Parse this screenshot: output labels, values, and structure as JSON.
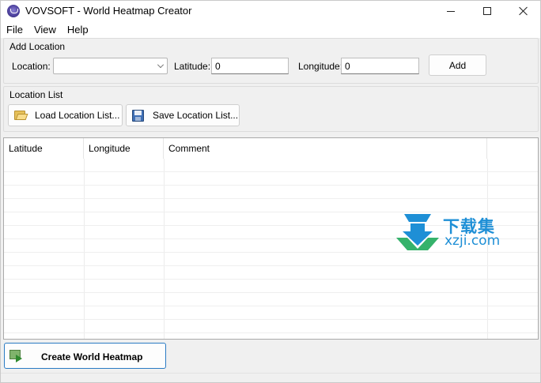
{
  "window": {
    "title": "VOVSOFT - World Heatmap Creator"
  },
  "menu": {
    "items": [
      "File",
      "View",
      "Help"
    ]
  },
  "add_location": {
    "group_title": "Add Location",
    "location_label": "Location:",
    "location_value": "",
    "latitude_label": "Latitude:",
    "latitude_value": "0",
    "longitude_label": "Longitude:",
    "longitude_value": "0",
    "add_button": "Add"
  },
  "location_list": {
    "group_title": "Location List",
    "load_button": "Load Location List...",
    "save_button": "Save Location List..."
  },
  "table": {
    "columns": [
      "Latitude",
      "Longitude",
      "Comment",
      ""
    ],
    "rows": []
  },
  "watermark": {
    "cn": "下载集",
    "en": "xzji.com"
  },
  "create_button": "Create World Heatmap",
  "colors": {
    "accent": "#2a7bc4",
    "watermark": "#1e8fd6"
  }
}
